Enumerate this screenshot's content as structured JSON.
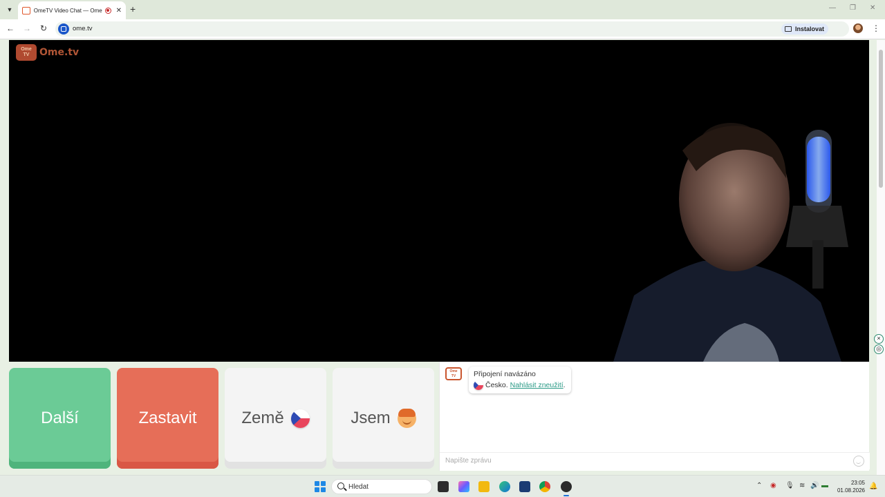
{
  "browser": {
    "tab_title": "OmeTV Video Chat — Ome",
    "new_tab": "+",
    "url": "ome.tv",
    "install_label": "Instalovat",
    "window_controls": [
      "—",
      "❐",
      "✕"
    ]
  },
  "logo": {
    "badge": "Ome\nTV",
    "text": "Ome.tv"
  },
  "controls": {
    "next_label": "Další",
    "stop_label": "Zastavit",
    "country_label": "Země",
    "gender_label": "Jsem"
  },
  "chat": {
    "avatar": "Ome\nTV",
    "status_title": "Připojení navázáno",
    "country": "Česko.",
    "report_link": "Nahlásit zneužití",
    "period": ".",
    "input_placeholder": "Napište zprávu"
  },
  "taskbar": {
    "search_label": "Hledat",
    "time": "23:05",
    "date": "01.08.2026"
  },
  "colors": {
    "next": "#6bcb96",
    "stop": "#e66e58",
    "accent_link": "#2a9a86",
    "brand": "#b05535"
  }
}
